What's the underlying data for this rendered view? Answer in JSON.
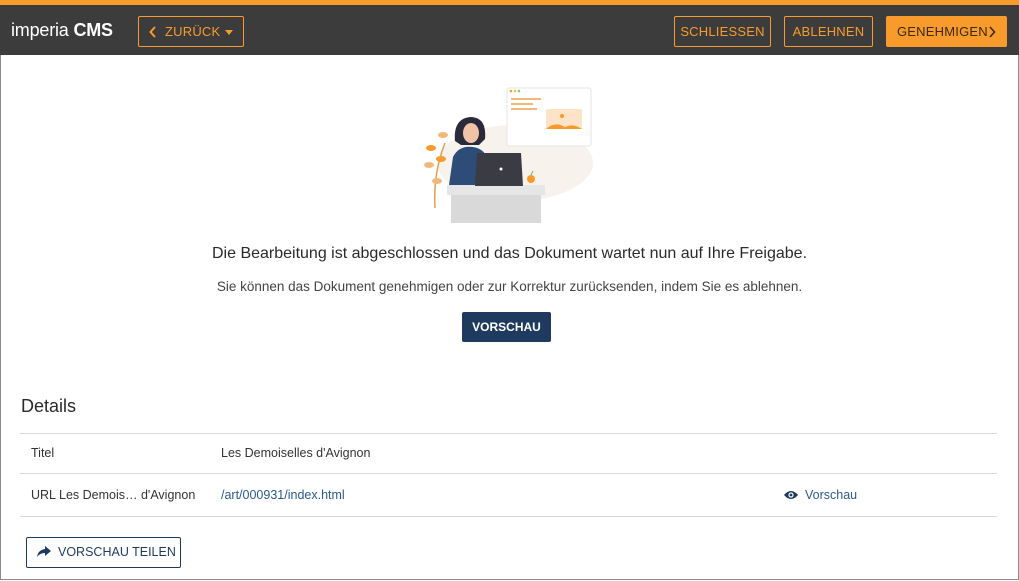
{
  "header": {
    "logo_light": "imperia",
    "logo_bold": "CMS",
    "back_label": "ZURÜCK",
    "close_label": "SCHLIESSEN",
    "reject_label": "ABLEHNEN",
    "approve_label": "GENEHMIGEN"
  },
  "main": {
    "message": "Die Bearbeitung ist abgeschlossen und das Dokument wartet nun auf Ihre Freigabe.",
    "submessage": "Sie können das Dokument genehmigen oder zur Korrektur zurücksenden, indem Sie es ablehnen.",
    "preview_button": "VORSCHAU"
  },
  "details": {
    "title": "Details",
    "rows": [
      {
        "label": "Titel",
        "value": "Les Demoiselles d'Avignon"
      },
      {
        "label": "URL Les Demois… d'Avignon",
        "value": "/art/000931/index.html",
        "action": "Vorschau"
      }
    ],
    "share_button": "VORSCHAU TEILEN"
  },
  "colors": {
    "accent": "#f89b2c",
    "topbar": "#3c3c3c",
    "primary": "#1f3a5f",
    "link": "#2b5a8c"
  },
  "icons": {
    "back": "chevron-left-icon",
    "dropdown": "caret-down-icon",
    "approve": "chevron-right-icon",
    "preview": "eye-icon",
    "share": "share-arrow-icon"
  }
}
